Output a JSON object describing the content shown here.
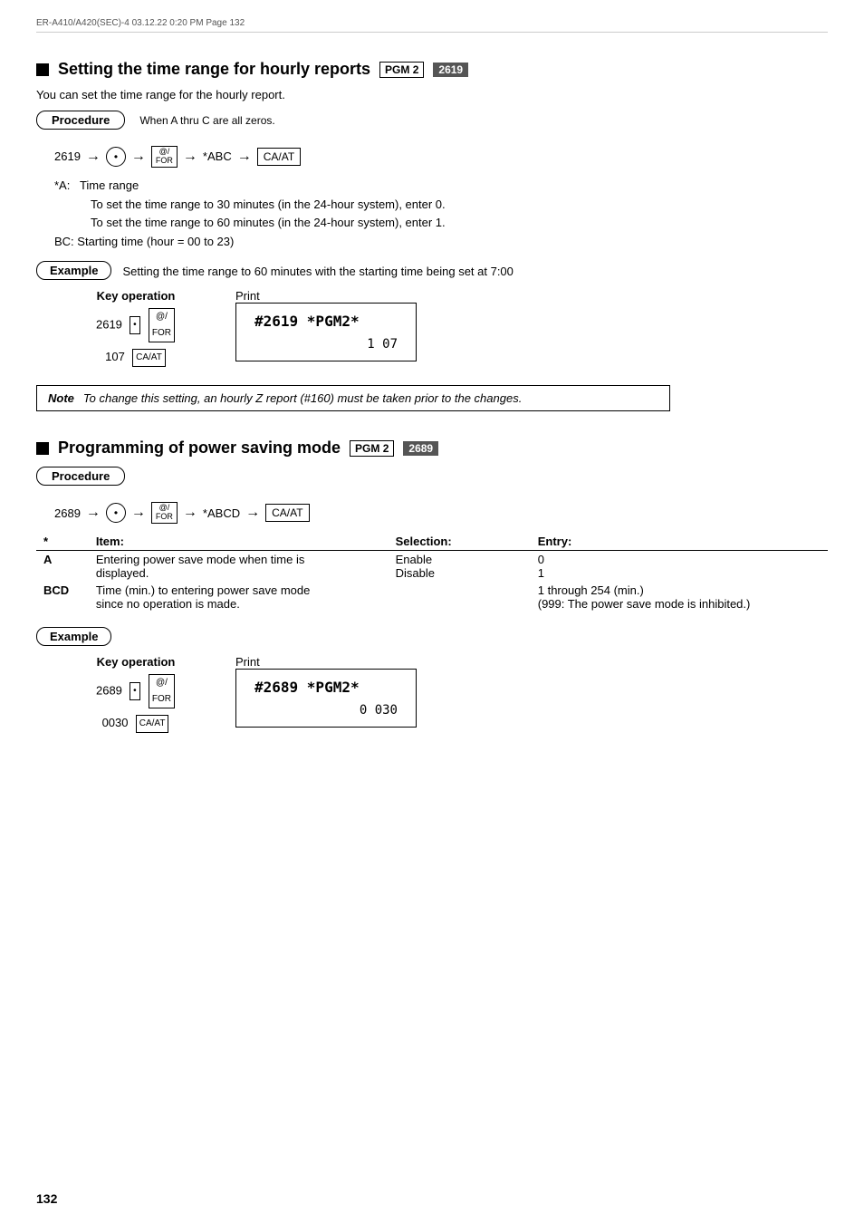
{
  "header": {
    "text": "ER-A410/A420(SEC)-4  03.12.22 0:20 PM  Page 132"
  },
  "section1": {
    "title": "Setting the time range for hourly reports",
    "pgm_badge": "PGM 2",
    "num_badge": "2619",
    "subtitle": "You can set the time range for the hourly report.",
    "procedure_label": "Procedure",
    "flow_when_text": "When A thru C are all zeros.",
    "flow_start": "2619",
    "flow_dot": "•",
    "flow_key1_top": "@/",
    "flow_key1_bot": "FOR",
    "flow_abc": "*ABC",
    "flow_caat": "CA/AT",
    "notes": [
      "*A:   Time range",
      "        To set the time range to 30 minutes (in the 24-hour system), enter 0.",
      "        To set the time range to 60 minutes (in the 24-hour system), enter 1.",
      "BC: Starting time (hour = 00 to 23)"
    ],
    "example_label": "Example",
    "example_desc": "Setting the time range to 60 minutes with the starting time being set at 7:00",
    "key_operation_header": "Key operation",
    "print_header": "Print",
    "key_ops": [
      "2619  •  @/FOR",
      "107  CA/AT"
    ],
    "print_line1": "#2619 *PGM2*",
    "print_line2": "1 07",
    "note_label": "Note",
    "note_text": "To change this setting, an hourly Z report (#160) must be taken prior to the changes."
  },
  "section2": {
    "title": "Programming of power saving mode",
    "pgm_badge": "PGM 2",
    "num_badge": "2689",
    "procedure_label": "Procedure",
    "flow_start": "2689",
    "flow_dot": "•",
    "flow_key1_top": "@/",
    "flow_key1_bot": "FOR",
    "flow_abcd": "*ABCD",
    "flow_caat": "CA/AT",
    "table": {
      "headers": [
        "*  Item:",
        "",
        "Selection:",
        "Entry:"
      ],
      "rows": [
        {
          "item_code": "A",
          "item_desc": "Entering power save mode when time is displayed.",
          "selections": [
            "Enable",
            "Disable"
          ],
          "entries": [
            "0",
            "1"
          ]
        },
        {
          "item_code": "BCD",
          "item_desc": "Time (min.) to entering power save mode since no operation is made.",
          "selections": [
            ""
          ],
          "entries": [
            "1 through 254 (min.)",
            "(999: The power save mode is inhibited.)"
          ]
        }
      ]
    },
    "example_label": "Example",
    "key_operation_header": "Key operation",
    "print_header": "Print",
    "key_ops": [
      "2689  •  @/FOR",
      "0030  CA/AT"
    ],
    "print_line1": "#2689 *PGM2*",
    "print_line2": "0 030"
  },
  "page_number": "132"
}
